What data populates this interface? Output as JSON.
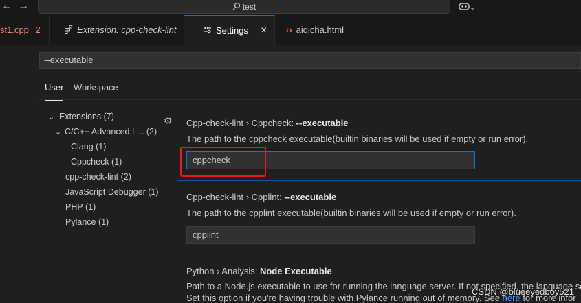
{
  "titlebar": {
    "back_icon": "arrow-left-icon",
    "forward_icon": "arrow-right-icon",
    "search_text": "test",
    "copilot_icon": "copilot-icon"
  },
  "tabs": [
    {
      "label": "st1.cpp",
      "badge": "2",
      "color": "#f48771"
    },
    {
      "label": "Extension: cpp-check-lint",
      "icon": "extensions-icon"
    },
    {
      "label": "Settings",
      "icon": "settings-icon",
      "close": "×",
      "active": true
    },
    {
      "label": "aiqicha.html",
      "icon": "html-code-icon"
    }
  ],
  "settings_search": {
    "value": "--executable"
  },
  "scope_tabs": {
    "user": "User",
    "workspace": "Workspace"
  },
  "tree": [
    {
      "label": "Extensions (7)",
      "expanded": true
    },
    {
      "label": "C/C++ Advanced L... (2)",
      "expanded": true
    },
    {
      "label": "Clang (1)"
    },
    {
      "label": "Cppcheck (1)"
    },
    {
      "label": "cpp-check-lint (2)"
    },
    {
      "label": "JavaScript Debugger (1)"
    },
    {
      "label": "PHP (1)"
    },
    {
      "label": "Pylance (1)"
    }
  ],
  "settings": [
    {
      "category": "Cpp-check-lint › Cppcheck: ",
      "name": "--executable",
      "description": "The path to the cppcheck executable(builtin binaries will be used if empty or run error).",
      "value": "cppcheck"
    },
    {
      "category": "Cpp-check-lint › Cpplint: ",
      "name": "--executable",
      "description": "The path to the cpplint executable(builtin binaries will be used if empty or run error).",
      "value": "cpplint"
    },
    {
      "category": "Python › Analysis: ",
      "name": "Node Executable",
      "description_line1": "Path to a Node.js executable to use for running the language server. If not specified, the language se",
      "description_line2_pre": "Set this option if you're having trouble with Pylance running out of memory. See ",
      "description_link": "here",
      "description_line2_post": " for more infor"
    }
  ],
  "watermark": "CSDN @blueeyedboy521",
  "colors": {
    "accent": "#0078d4",
    "highlight_box": "#e0201e",
    "error_tab": "#f48771"
  }
}
